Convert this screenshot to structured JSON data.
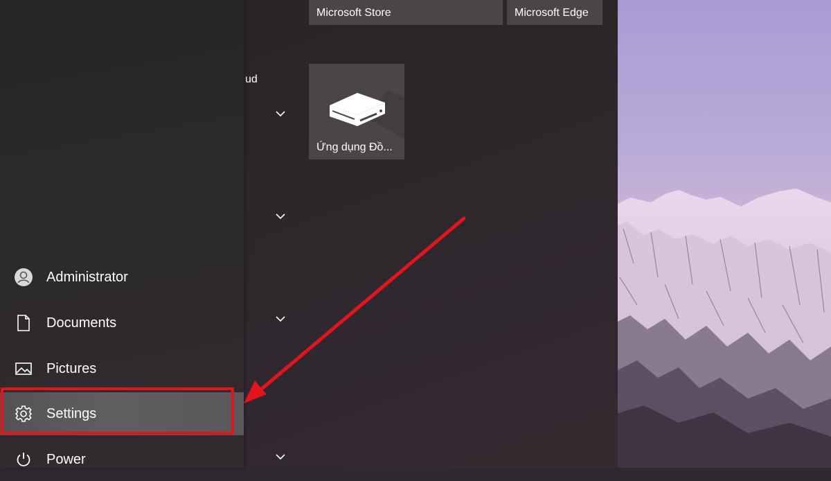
{
  "tiles": {
    "store_label": "Microsoft Store",
    "edge_label": "Microsoft Edge",
    "app_label": "Ứng dụng Đồ..."
  },
  "app_list": {
    "partial_text": "ud"
  },
  "nav": {
    "user_label": "Administrator",
    "documents_label": "Documents",
    "pictures_label": "Pictures",
    "settings_label": "Settings",
    "power_label": "Power"
  },
  "colors": {
    "highlight": "#e3141b",
    "arrow": "#e3141b",
    "active_item": "#5a585a"
  },
  "icons": {
    "user": "user-avatar-icon",
    "documents": "document-icon",
    "pictures": "picture-icon",
    "settings": "gear-icon",
    "power": "power-icon",
    "expand": "chevron-down-icon",
    "app_tile": "device-box-icon"
  }
}
